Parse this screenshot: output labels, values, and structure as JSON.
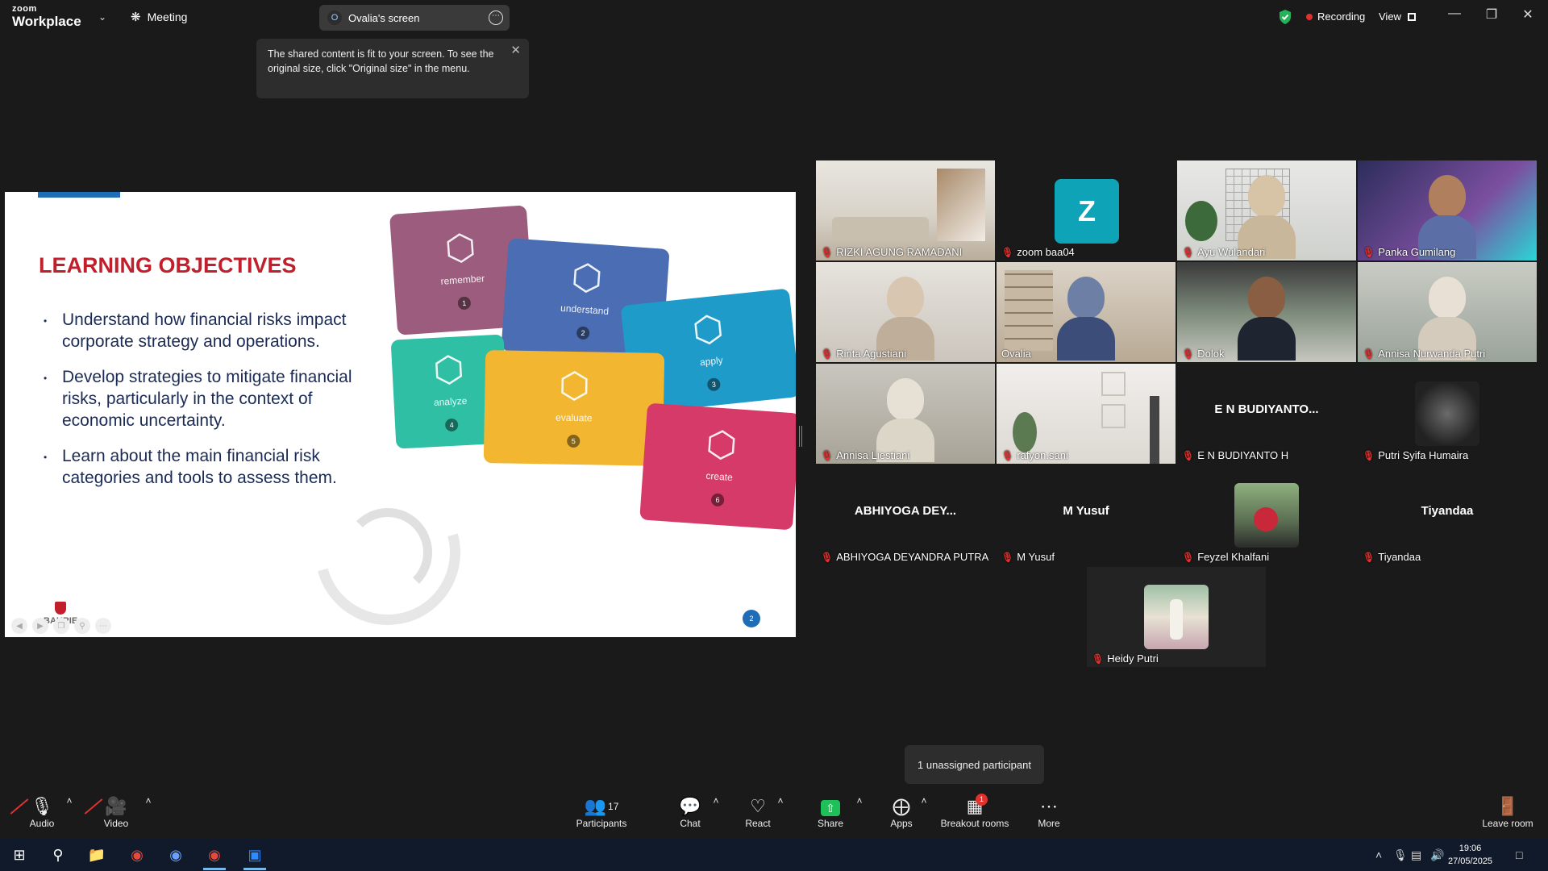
{
  "app": {
    "brand_top": "zoom",
    "brand_bottom": "Workplace",
    "meeting_label": "Meeting",
    "screen_initial": "O",
    "screen_label": "Ovalia's screen",
    "recording_label": "Recording",
    "view_label": "View"
  },
  "tooltip": {
    "text": "The shared content is fit to your screen. To see the original size, click \"Original size\" in the menu."
  },
  "slide": {
    "title": "LEARNING OBJECTIVES",
    "bullets": [
      "Understand how financial risks impact corporate strategy and operations.",
      "Develop strategies to mitigate financial risks, particularly in the context of economic uncertainty.",
      "Learn about the main financial risk categories and tools to assess them."
    ],
    "cards": [
      {
        "label": "remember",
        "num": "1",
        "color": "#9b5c7d"
      },
      {
        "label": "understand",
        "num": "2",
        "color": "#4a6db3"
      },
      {
        "label": "analyze",
        "num": "4",
        "color": "#2ebfa5"
      },
      {
        "label": "apply",
        "num": "3",
        "color": "#1f9bc9"
      },
      {
        "label": "evaluate",
        "num": "5",
        "color": "#f2b631"
      },
      {
        "label": "create",
        "num": "6",
        "color": "#d63a68"
      }
    ],
    "logo_text": "BAKRIE",
    "page_badge": "2"
  },
  "gallery": [
    {
      "name": "RIZKI AGUNG RAMADANI",
      "type": "video"
    },
    {
      "name": "zoom baa04",
      "type": "letter",
      "letter": "Z"
    },
    {
      "name": "Ayu Wulandari",
      "type": "video"
    },
    {
      "name": "Panka Gumilang",
      "type": "video"
    },
    {
      "name": "Rinta Agustiani",
      "type": "video"
    },
    {
      "name": "Ovalia",
      "type": "video",
      "active": true
    },
    {
      "name": "Dolok",
      "type": "video"
    },
    {
      "name": "Annisa Nurwanda Putri",
      "type": "video"
    },
    {
      "name": "Annisa Liestiani",
      "type": "video"
    },
    {
      "name": "rafyon.sani",
      "type": "video"
    },
    {
      "name": "E N BUDIYANTO H",
      "type": "text",
      "big": "E N BUDIYANTO..."
    },
    {
      "name": "Putri Syifa Humaira",
      "type": "avatar"
    },
    {
      "name": "ABHIYOGA DEYANDRA PUTRA",
      "type": "text",
      "big": "ABHIYOGA DEY..."
    },
    {
      "name": "M Yusuf",
      "type": "text",
      "big": "M Yusuf"
    },
    {
      "name": "Feyzel Khalfani",
      "type": "avatar"
    },
    {
      "name": "Tiyandaa",
      "type": "text",
      "big": "Tiyandaa"
    },
    {
      "name": "Heidy Putri",
      "type": "avatar"
    }
  ],
  "unassigned": "1 unassigned participant",
  "toolbar": {
    "audio": "Audio",
    "video": "Video",
    "participants": "Participants",
    "participants_count": "17",
    "chat": "Chat",
    "react": "React",
    "share": "Share",
    "apps": "Apps",
    "breakout": "Breakout rooms",
    "breakout_badge": "1",
    "more": "More",
    "leave": "Leave room"
  },
  "taskbar": {
    "time": "19:06",
    "date": "27/05/2025"
  }
}
